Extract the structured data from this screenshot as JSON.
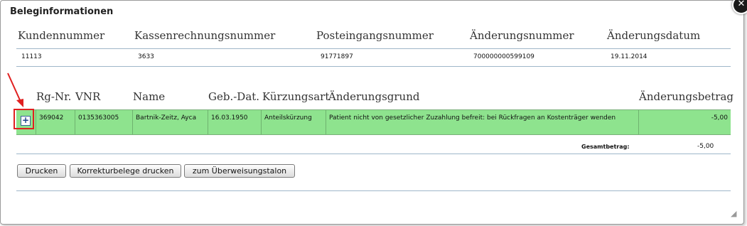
{
  "dialog": {
    "title": "Beleginformationen",
    "close_glyph": "✕"
  },
  "info": {
    "headers": [
      "Kundennummer",
      "Kassenrechnungsnummer",
      "Posteingangsnummer",
      "Änderungsnummer",
      "Änderungsdatum"
    ],
    "values": [
      "11113",
      "3633",
      "91771897",
      "700000000599109",
      "19.11.2014"
    ]
  },
  "table": {
    "headers": [
      "Rg-Nr.",
      "VNR",
      "Name",
      "Geb.-Dat.",
      "Kürzungsart",
      "Änderungsgrund",
      "Änderungsbetrag"
    ],
    "rows": [
      {
        "expand_glyph": "+",
        "rg_nr": "369042",
        "vnr": "0135363005",
        "name": "Bartnik-Zeitz, Ayca",
        "geb_dat": "16.03.1950",
        "kuerzungsart": "Anteilskürzung",
        "aenderungsgrund": "Patient nicht von gesetzlicher Zuzahlung befreit: bei Rückfragen an Kostenträger wenden",
        "aenderungsbetrag": "-5,00"
      }
    ],
    "total_label": "Gesamtbetrag:",
    "total_value": "-5,00",
    "highlight_color": "#8ee38e"
  },
  "buttons": {
    "print": "Drucken",
    "print_corrections": "Korrekturbelege drucken",
    "transfer_slip": "zum Überweisungstalon"
  },
  "annotation": {
    "color": "#e02020",
    "resize_glyph": "◢"
  }
}
